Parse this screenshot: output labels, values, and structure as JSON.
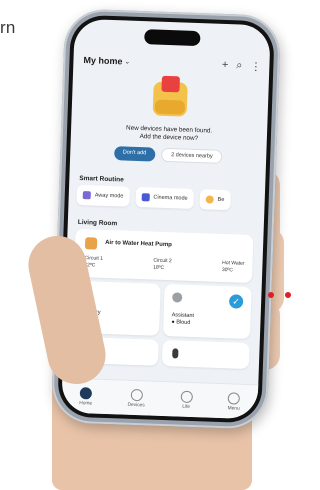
{
  "corner_text": "rn",
  "app": {
    "header_title": "My home",
    "icons": [
      "plus-icon",
      "search-icon",
      "more-icon"
    ],
    "notice": {
      "line1": "New devices have been found.",
      "line2": "Add the device now?",
      "primary_button": "Don't add",
      "secondary_button": "2 devices nearby"
    },
    "smart_routine": {
      "title": "Smart Routine",
      "chips": [
        "Away mode",
        "Cinema mode",
        "Be"
      ]
    },
    "living_room": {
      "title": "Living Room",
      "heat_pump": {
        "name": "Air to Water Heat Pump",
        "metrics": [
          {
            "label": "Circuit 1",
            "value": "32ºC"
          },
          {
            "label": "Circuit 2",
            "value": "18ºC"
          },
          {
            "label": "Hot Water",
            "value": "30ºC"
          }
        ]
      },
      "tiles": [
        {
          "name": "Laundry",
          "status": "On"
        },
        {
          "name": "Assistant",
          "status": "● Bloud"
        },
        {
          "name": "",
          "status": ""
        },
        {
          "name": "",
          "status": ""
        }
      ]
    },
    "nav": [
      "Home",
      "Devices",
      "Life",
      "Menu"
    ]
  }
}
